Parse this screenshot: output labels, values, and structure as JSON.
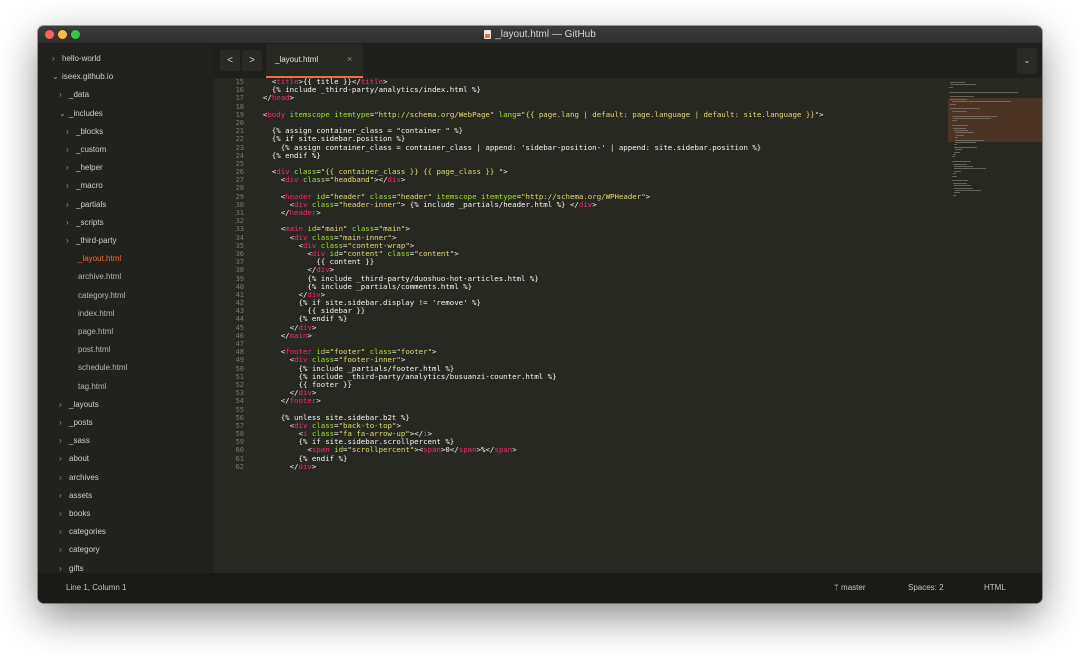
{
  "window": {
    "title": "_layout.html — GitHub"
  },
  "sidebar": {
    "items": [
      {
        "label": "hello-world",
        "kind": "folder",
        "indent": 1,
        "open": false
      },
      {
        "label": "iseex.github.io",
        "kind": "folder",
        "indent": 1,
        "open": true
      },
      {
        "label": "_data",
        "kind": "folder",
        "indent": 2,
        "open": false
      },
      {
        "label": "_includes",
        "kind": "folder",
        "indent": 2,
        "open": true
      },
      {
        "label": "_blocks",
        "kind": "folder",
        "indent": 3,
        "open": false
      },
      {
        "label": "_custom",
        "kind": "folder",
        "indent": 3,
        "open": false
      },
      {
        "label": "_helper",
        "kind": "folder",
        "indent": 3,
        "open": false
      },
      {
        "label": "_macro",
        "kind": "folder",
        "indent": 3,
        "open": false
      },
      {
        "label": "_partials",
        "kind": "folder",
        "indent": 3,
        "open": false
      },
      {
        "label": "_scripts",
        "kind": "folder",
        "indent": 3,
        "open": false
      },
      {
        "label": "_third-party",
        "kind": "folder",
        "indent": 3,
        "open": false
      },
      {
        "label": "_layout.html",
        "kind": "file",
        "indent": 3,
        "active": true
      },
      {
        "label": "archive.html",
        "kind": "file",
        "indent": 3
      },
      {
        "label": "category.html",
        "kind": "file",
        "indent": 3
      },
      {
        "label": "index.html",
        "kind": "file",
        "indent": 3
      },
      {
        "label": "page.html",
        "kind": "file",
        "indent": 3
      },
      {
        "label": "post.html",
        "kind": "file",
        "indent": 3
      },
      {
        "label": "schedule.html",
        "kind": "file",
        "indent": 3
      },
      {
        "label": "tag.html",
        "kind": "file",
        "indent": 3
      },
      {
        "label": "_layouts",
        "kind": "folder",
        "indent": 2,
        "open": false
      },
      {
        "label": "_posts",
        "kind": "folder",
        "indent": 2,
        "open": false
      },
      {
        "label": "_sass",
        "kind": "folder",
        "indent": 2,
        "open": false
      },
      {
        "label": "about",
        "kind": "folder",
        "indent": 2,
        "open": false
      },
      {
        "label": "archives",
        "kind": "folder",
        "indent": 2,
        "open": false
      },
      {
        "label": "assets",
        "kind": "folder",
        "indent": 2,
        "open": false
      },
      {
        "label": "books",
        "kind": "folder",
        "indent": 2,
        "open": false
      },
      {
        "label": "categories",
        "kind": "folder",
        "indent": 2,
        "open": false
      },
      {
        "label": "category",
        "kind": "folder",
        "indent": 2,
        "open": false
      },
      {
        "label": "gifts",
        "kind": "folder",
        "indent": 2,
        "open": false
      }
    ]
  },
  "tabs": [
    {
      "label": "_layout.html",
      "active": true,
      "close": "×"
    }
  ],
  "nav": {
    "back": "<",
    "forward": ">",
    "more": "⌄"
  },
  "editor": {
    "line_numbers": [
      "15",
      "16",
      "17",
      "18",
      "19",
      "20",
      "21",
      "22",
      "23",
      "24",
      "25",
      "26",
      "27",
      "28",
      "29",
      "30",
      "31",
      "32",
      "33",
      "34",
      "35",
      "36",
      "37",
      "38",
      "39",
      "40",
      "41",
      "42",
      "43",
      "44",
      "45",
      "46",
      "47",
      "48",
      "49",
      "50",
      "51",
      "52",
      "53",
      "54",
      "55",
      "56",
      "57",
      "58",
      "59",
      "60",
      "61",
      "62"
    ],
    "lines": [
      "    <title>{{ title }}</title>",
      "    {% include _third-party/analytics/index.html %}",
      "  </head>",
      "",
      "  <body itemscope itemtype=\"http://schema.org/WebPage\" lang=\"{{ page.lang | default: page.language | default: site.language }}\">",
      "",
      "    {% assign container_class = \"container \" %}",
      "    {% if site.sidebar.position %}",
      "      {% assign container_class = container_class | append: 'sidebar-position-' | append: site.sidebar.position %}",
      "    {% endif %}",
      "",
      "    <div class=\"{{ container_class }} {{ page_class }} \">",
      "      <div class=\"headband\"></div>",
      "",
      "      <header id=\"header\" class=\"header\" itemscope itemtype=\"http://schema.org/WPHeader\">",
      "        <div class=\"header-inner\"> {% include _partials/header.html %} </div>",
      "      </header>",
      "",
      "      <main id=\"main\" class=\"main\">",
      "        <div class=\"main-inner\">",
      "          <div class=\"content-wrap\">",
      "            <div id=\"content\" class=\"content\">",
      "              {{ content }}",
      "            </div>",
      "            {% include _third-party/duoshuo-hot-articles.html %}",
      "            {% include _partials/comments.html %}",
      "          </div>",
      "          {% if site.sidebar.display != 'remove' %}",
      "            {{ sidebar }}",
      "          {% endif %}",
      "        </div>",
      "      </main>",
      "",
      "      <footer id=\"footer\" class=\"footer\">",
      "        <div class=\"footer-inner\">",
      "          {% include _partials/footer.html %}",
      "          {% include _third-party/analytics/busuanzi-counter.html %}",
      "          {{ footer }}",
      "        </div>",
      "      </footer>",
      "",
      "      {% unless site.sidebar.b2t %}",
      "        <div class=\"back-to-top\">",
      "          <i class=\"fa fa-arrow-up\"></i>",
      "          {% if site.sidebar.scrollpercent %}",
      "            <span id=\"scrollpercent\"><span>0</span>%</span>",
      "          {% endif %}",
      "        </div>"
    ]
  },
  "status": {
    "position": "Line 1, Column 1",
    "branch": "master",
    "spaces": "Spaces: 2",
    "syntax": "HTML"
  },
  "colors": {
    "accent": "#f26d3d",
    "tag": "#f92672",
    "attr": "#a6e22e",
    "string": "#e6db74",
    "text": "#f8f8f2",
    "background": "#272822"
  }
}
